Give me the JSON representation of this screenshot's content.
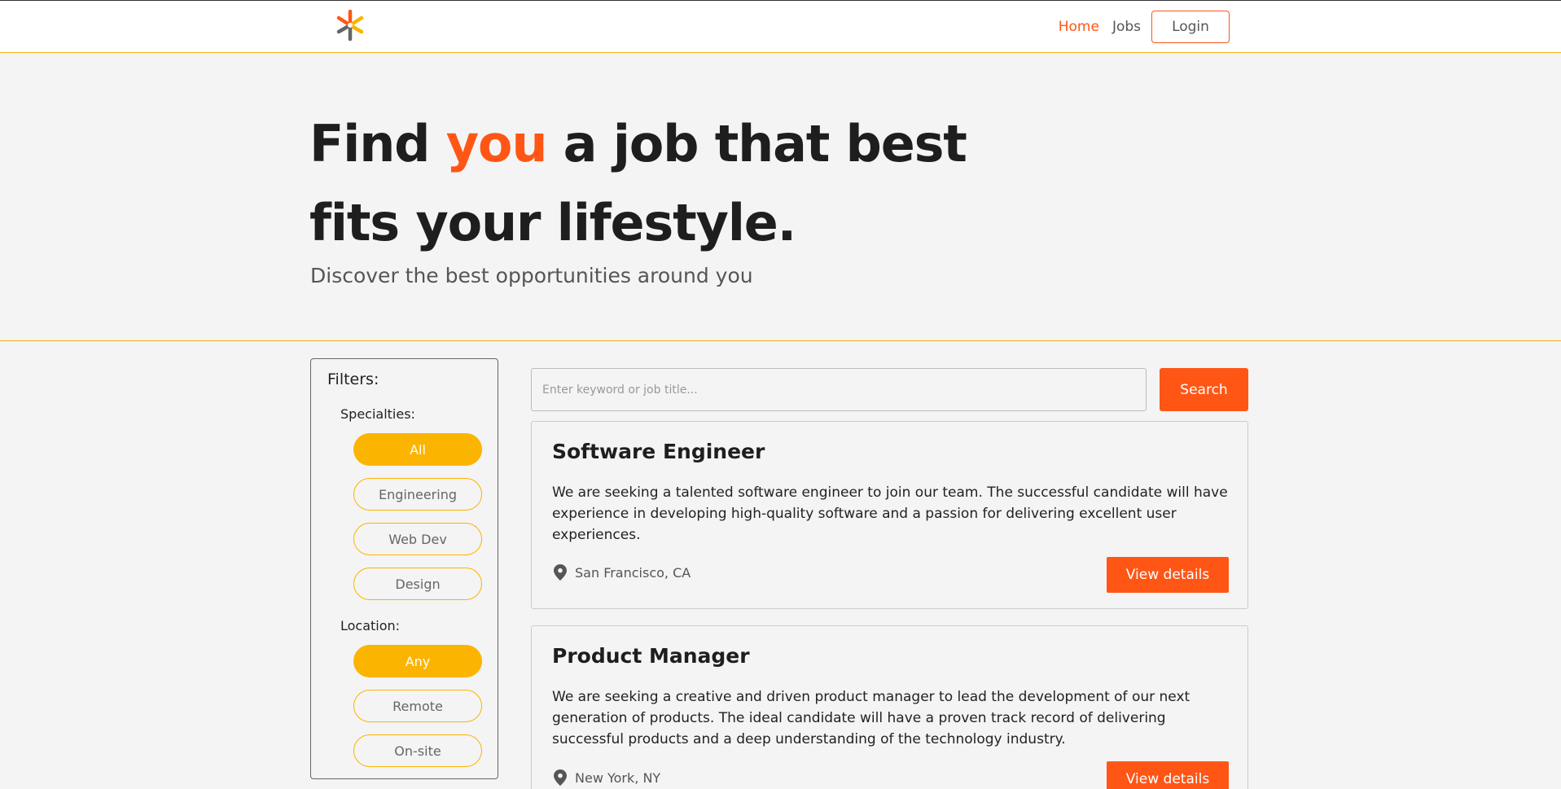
{
  "colors": {
    "accent": "#ff5616",
    "filter_accent": "#fbb400",
    "divider": "#f2b21b",
    "background": "#f4f4f4"
  },
  "header": {
    "logo": "asterisk-logo-icon",
    "nav": {
      "home": "Home",
      "jobs": "Jobs",
      "login": "Login"
    }
  },
  "hero": {
    "title_part1": "Find ",
    "title_accent": "you",
    "title_part2": " a job that best fits your lifestyle.",
    "subtitle": "Discover the best opportunities around you"
  },
  "filters": {
    "title": "Filters:",
    "specialties_label": "Specialties:",
    "specialties": [
      {
        "label": "All",
        "active": true
      },
      {
        "label": "Engineering",
        "active": false
      },
      {
        "label": "Web Dev",
        "active": false
      },
      {
        "label": "Design",
        "active": false
      }
    ],
    "location_label": "Location:",
    "locations": [
      {
        "label": "Any",
        "active": true
      },
      {
        "label": "Remote",
        "active": false
      },
      {
        "label": "On-site",
        "active": false
      }
    ]
  },
  "search": {
    "placeholder": "Enter keyword or job title...",
    "button": "Search"
  },
  "jobs": [
    {
      "title": "Software Engineer",
      "description": "We are seeking a talented software engineer to join our team. The successful candidate will have experience in developing high-quality software and a passion for delivering excellent user experiences.",
      "location": "San Francisco, CA",
      "button": "View details",
      "icon": "location-pin-icon"
    },
    {
      "title": "Product Manager",
      "description": "We are seeking a creative and driven product manager to lead the development of our next generation of products. The ideal candidate will have a proven track record of delivering successful products and a deep understanding of the technology industry.",
      "location": "New York, NY",
      "button": "View details",
      "icon": "location-pin-icon"
    }
  ]
}
